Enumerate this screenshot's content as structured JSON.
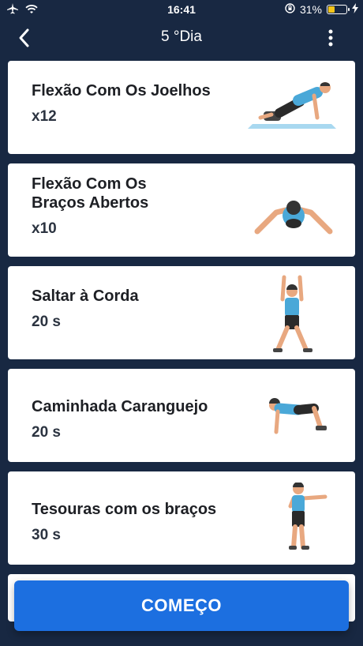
{
  "status": {
    "time": "16:41",
    "battery": "31%"
  },
  "header": {
    "title": "5 °Dia"
  },
  "exercises": [
    {
      "name": "Flexão Com Os Joelhos",
      "reps": "x12"
    },
    {
      "name_line1": "Flexão Com Os",
      "name_line2": "Braços Abertos",
      "reps": "x10"
    },
    {
      "name": "Saltar à Corda",
      "reps": "20 s"
    },
    {
      "name": "Caminhada Caranguejo",
      "reps": "20 s"
    },
    {
      "name": "Tesouras com os braços",
      "reps": "30 s"
    }
  ],
  "start_button": {
    "label": "COMEÇO"
  },
  "colors": {
    "background": "#182842",
    "accent": "#1c6fe0",
    "card": "#ffffff"
  }
}
